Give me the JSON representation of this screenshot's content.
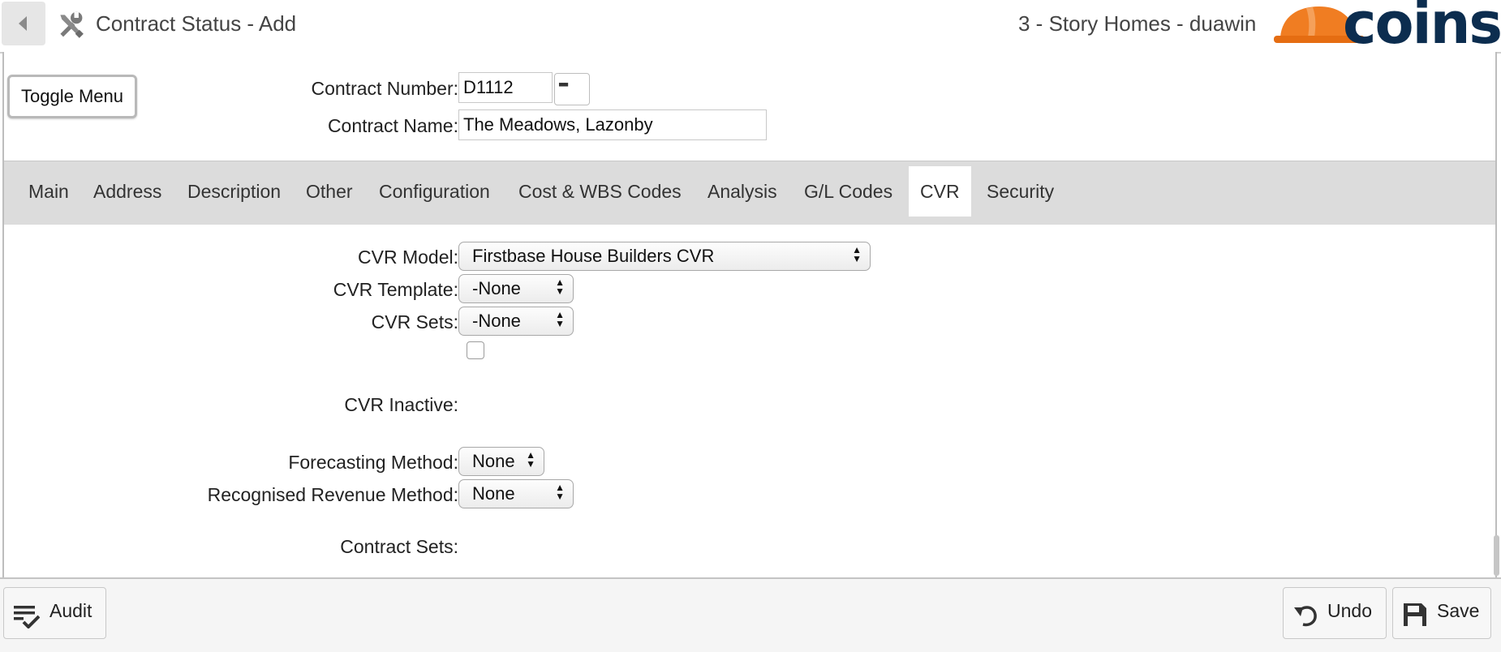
{
  "header": {
    "title": "Contract Status - Add",
    "company": "3 - Story Homes - duawin",
    "logo_text": "coins",
    "brand_color": "#f07d22"
  },
  "form_top": {
    "toggle_menu": "Toggle Menu",
    "contract_number_label": "Contract Number:",
    "contract_number_value": "D1112",
    "contract_name_label": "Contract Name:",
    "contract_name_value": "The Meadows, Lazonby"
  },
  "tabs": [
    {
      "label": "Main"
    },
    {
      "label": "Address"
    },
    {
      "label": "Description"
    },
    {
      "label": "Other"
    },
    {
      "label": "Configuration"
    },
    {
      "label": "Cost & WBS Codes"
    },
    {
      "label": "Analysis"
    },
    {
      "label": "G/L Codes"
    },
    {
      "label": "CVR",
      "active": true
    },
    {
      "label": "Security"
    }
  ],
  "cvr": {
    "model_label": "CVR Model:",
    "model_value": "Firstbase House Builders CVR",
    "template_label": "CVR Template:",
    "template_value": "-None",
    "sets_label": "CVR Sets:",
    "sets_value": "-None",
    "inactive_label": "CVR Inactive:",
    "inactive_checked": false,
    "forecasting_label": "Forecasting Method:",
    "forecasting_value": "None",
    "revenue_label": "Recognised Revenue Method:",
    "revenue_value": "None",
    "contract_sets_label": "Contract Sets:"
  },
  "footer": {
    "audit_label": "Audit",
    "undo_label": "Undo",
    "save_label": "Save"
  }
}
